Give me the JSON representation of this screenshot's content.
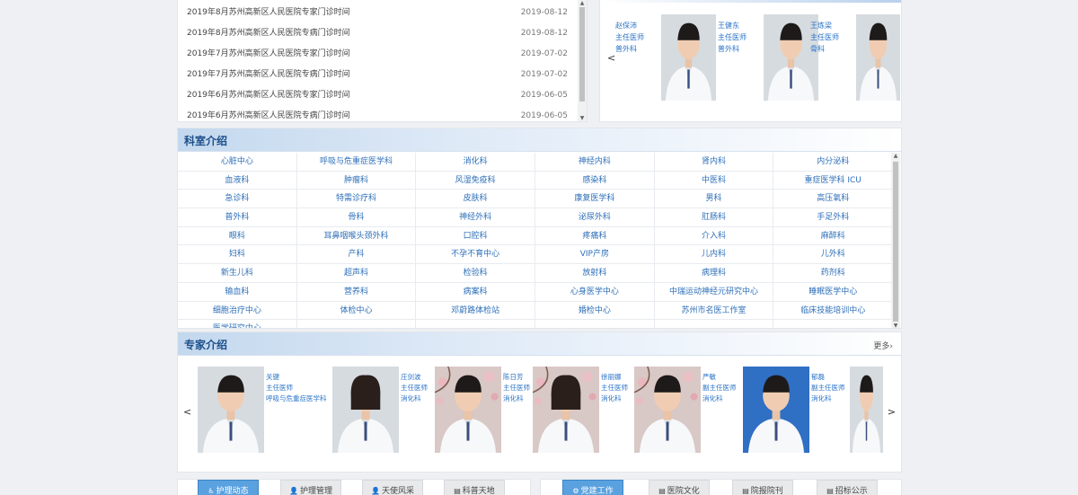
{
  "news": {
    "items": [
      {
        "title": "2019年8月苏州高新区人民医院专家门诊时间",
        "date": "2019-08-12"
      },
      {
        "title": "2019年8月苏州高新区人民医院专病门诊时间",
        "date": "2019-08-12"
      },
      {
        "title": "2019年7月苏州高新区人民医院专家门诊时间",
        "date": "2019-07-02"
      },
      {
        "title": "2019年7月苏州高新区人民医院专病门诊时间",
        "date": "2019-07-02"
      },
      {
        "title": "2019年6月苏州高新区人民医院专家门诊时间",
        "date": "2019-06-05"
      },
      {
        "title": "2019年6月苏州高新区人民医院专病门诊时间",
        "date": "2019-06-05"
      }
    ]
  },
  "top_doctors": {
    "prev": "<",
    "next": ">",
    "items": [
      {
        "name": "赵保沛",
        "title": "主任医师",
        "dept": "普外科"
      },
      {
        "name": "王健东",
        "title": "主任医师",
        "dept": "普外科"
      },
      {
        "name": "王炼梁",
        "title": "主任医师",
        "dept": "骨科"
      }
    ]
  },
  "departments": {
    "title": "科室介绍",
    "rows": [
      [
        "心脏中心",
        "呼吸与危重症医学科",
        "消化科",
        "神经内科",
        "肾内科",
        "内分泌科"
      ],
      [
        "血液科",
        "肿瘤科",
        "风湿免疫科",
        "感染科",
        "中医科",
        "重症医学科 ICU"
      ],
      [
        "急诊科",
        "特需诊疗科",
        "皮肤科",
        "康复医学科",
        "男科",
        "高压氧科"
      ],
      [
        "普外科",
        "骨科",
        "神经外科",
        "泌尿外科",
        "肛肠科",
        "手足外科"
      ],
      [
        "眼科",
        "耳鼻咽喉头颈外科",
        "口腔科",
        "疼痛科",
        "介入科",
        "麻醉科"
      ],
      [
        "妇科",
        "产科",
        "不孕不育中心",
        "VIP产房",
        "儿内科",
        "儿外科"
      ],
      [
        "新生儿科",
        "超声科",
        "检验科",
        "放射科",
        "病理科",
        "药剂科"
      ],
      [
        "输血科",
        "营养科",
        "病案科",
        "心身医学中心",
        "中瑞运动神经元研究中心",
        "睡眠医学中心"
      ],
      [
        "细胞治疗中心",
        "体检中心",
        "邓蔚路体检站",
        "婚检中心",
        "苏州市名医工作室",
        "临床技能培训中心"
      ],
      [
        "医学研究中心",
        "",
        "",
        "",
        "",
        ""
      ]
    ]
  },
  "experts": {
    "title": "专家介绍",
    "more": "更多›",
    "prev": "<",
    "next": ">",
    "items": [
      {
        "name": "关键",
        "title": "主任医师",
        "dept": "呼吸与危重症医学科",
        "bg": "plain"
      },
      {
        "name": "庄剑波",
        "title": "主任医师",
        "dept": "消化科",
        "bg": "plain"
      },
      {
        "name": "陈日芳",
        "title": "主任医师",
        "dept": "消化科",
        "bg": "blossom"
      },
      {
        "name": "徐丽娜",
        "title": "主任医师",
        "dept": "消化科",
        "bg": "blossom"
      },
      {
        "name": "严敏",
        "title": "副主任医师",
        "dept": "消化科",
        "bg": "blossom"
      },
      {
        "name": "郁磊",
        "title": "副主任医师",
        "dept": "消化科",
        "bg": "blue"
      },
      {
        "name": "",
        "title": "",
        "dept": "",
        "bg": "plain"
      }
    ]
  },
  "tabs_left": [
    {
      "label": "护理动态",
      "icon": "wheelchair-icon",
      "active": true
    },
    {
      "label": "护理管理",
      "icon": "user-icon",
      "active": false
    },
    {
      "label": "天使风采",
      "icon": "user-icon",
      "active": false
    },
    {
      "label": "科普天地",
      "icon": "book-icon",
      "active": false
    }
  ],
  "tabs_right": [
    {
      "label": "党建工作",
      "icon": "gears-icon",
      "active": true
    },
    {
      "label": "医院文化",
      "icon": "doc-icon",
      "active": false
    },
    {
      "label": "院报院刊",
      "icon": "doc-icon",
      "active": false
    },
    {
      "label": "招标公示",
      "icon": "doc-icon",
      "active": false
    }
  ],
  "colors": {
    "link": "#2a73c7",
    "accent": "#5aa1e0",
    "header_blue": "#1c4f8a"
  }
}
